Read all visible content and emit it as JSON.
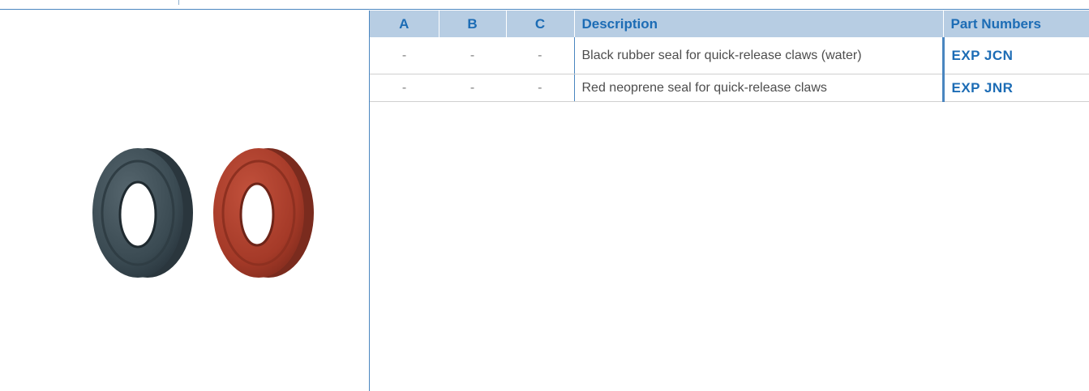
{
  "table": {
    "headers": {
      "a": "A",
      "b": "B",
      "c": "C",
      "description": "Description",
      "part_numbers": "Part Numbers"
    },
    "rows": [
      {
        "a": "-",
        "b": "-",
        "c": "-",
        "description": "Black rubber seal for quick-release claws (water)",
        "part_number": "EXP JCN"
      },
      {
        "a": "-",
        "b": "-",
        "c": "-",
        "description": "Red neoprene seal for quick-release claws",
        "part_number": "EXP JNR"
      }
    ]
  },
  "colors": {
    "header_bg": "#b7cde3",
    "accent_blue": "#1c6cb5",
    "rule_blue": "#4a86c0",
    "seal_black": "#3a4a52",
    "seal_red": "#a53a28"
  },
  "image": {
    "icons": [
      "black-rubber-seal-image",
      "red-neoprene-seal-image"
    ]
  }
}
